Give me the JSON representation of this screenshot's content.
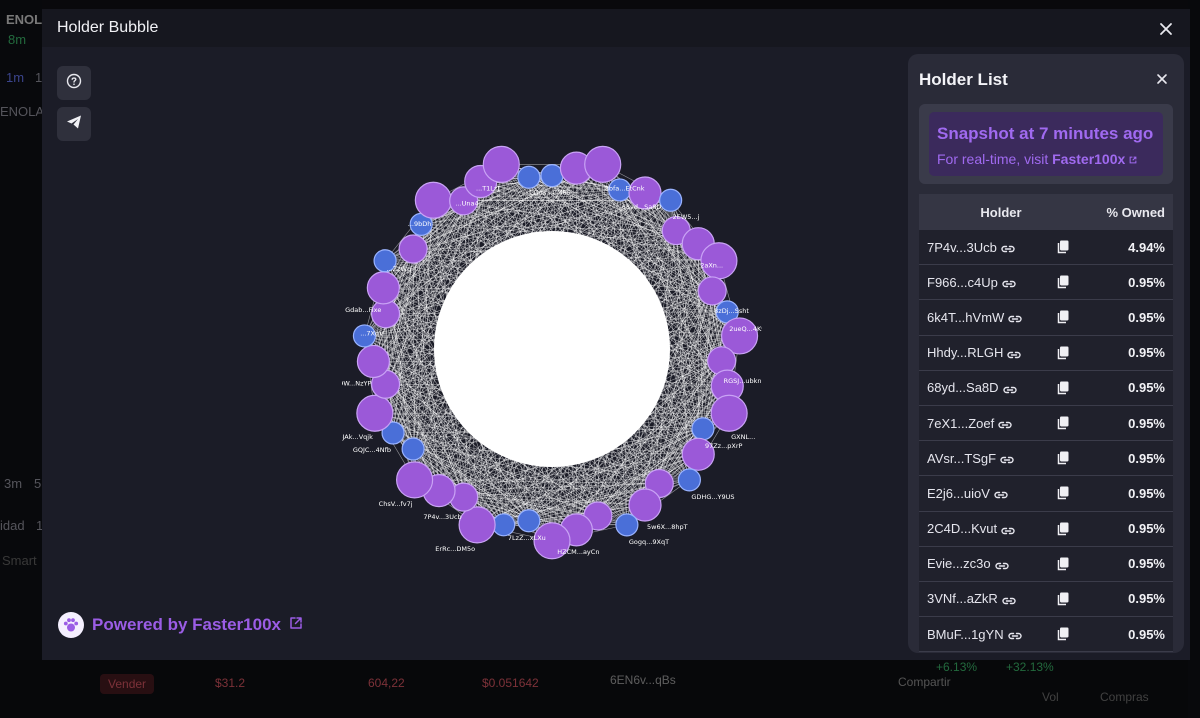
{
  "background": {
    "texts": [
      "ENOL",
      "8m",
      "1m",
      "1",
      "ENOLA",
      "3m",
      "5",
      "idad",
      "1",
      "Smart",
      "Vender",
      "$31.2",
      "604,22",
      "$0.051642",
      "6EN6v...qBs",
      "Compartir",
      "+6.13%",
      "+32.13%",
      "Vol",
      "Compras"
    ]
  },
  "modal": {
    "title": "Holder Bubble"
  },
  "tools": {
    "help_icon": "question-circle-icon",
    "telegram_icon": "send-icon"
  },
  "graph": {
    "labels": [
      "CQds...CME9",
      "8bfa...EtCnk",
      "68yd...Sa8D",
      "2EW5...j",
      "2aXn...",
      "8zDj...Ssht",
      "2ueQ...4K9e",
      "RGSJ...ubkn",
      "GXNL...",
      "97Zz...pXrP",
      "GDHG...Y9US",
      "5w6X...8hpT",
      "Gogq...9XqT",
      "HZCM...ayCn",
      "7LzZ...xLXu",
      "ErRc...DM5o",
      "7P4v...3Ucb",
      "ChsV...fv7j",
      "GQJC...4Nfb",
      "4JAk...Vqjk",
      "8p9W...NzYP",
      "...7XqV",
      "Gdab...Fixe",
      "...ZzWg",
      "...9bDh",
      "...Una4",
      "...T1LzJ"
    ],
    "purple": "#9b59d8",
    "blue": "#4a6fd8"
  },
  "powered": {
    "prefix": "Powered by ",
    "brand": "Faster100x"
  },
  "panel": {
    "title": "Holder List",
    "snapshot_title": "Snapshot at 7 minutes ago",
    "snapshot_prefix": "For real-time, visit ",
    "snapshot_brand": "Faster100x",
    "col_holder": "Holder",
    "col_owned": "% Owned",
    "rows": [
      {
        "addr": "7P4v...3Ucb",
        "pct": "4.94%"
      },
      {
        "addr": "F966...c4Up",
        "pct": "0.95%"
      },
      {
        "addr": "6k4T...hVmW",
        "pct": "0.95%"
      },
      {
        "addr": "Hhdy...RLGH",
        "pct": "0.95%"
      },
      {
        "addr": "68yd...Sa8D",
        "pct": "0.95%"
      },
      {
        "addr": "7eX1...Zoef",
        "pct": "0.95%"
      },
      {
        "addr": "AVsr...TSgF",
        "pct": "0.95%"
      },
      {
        "addr": "E2j6...uioV",
        "pct": "0.95%"
      },
      {
        "addr": "2C4D...Kvut",
        "pct": "0.95%"
      },
      {
        "addr": "Evie...zc3o",
        "pct": "0.95%"
      },
      {
        "addr": "3VNf...aZkR",
        "pct": "0.95%"
      },
      {
        "addr": "BMuF...1gYN",
        "pct": "0.95%"
      }
    ]
  }
}
